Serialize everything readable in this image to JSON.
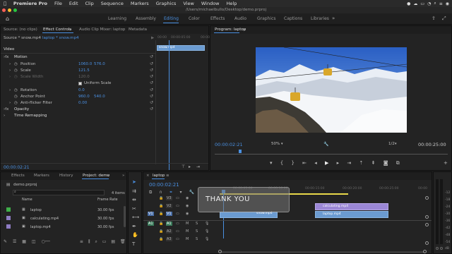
{
  "menubar": {
    "apple": "",
    "app": "Premiere Pro",
    "items": [
      "File",
      "Edit",
      "Clip",
      "Sequence",
      "Markers",
      "Graphics",
      "View",
      "Window",
      "Help"
    ]
  },
  "title": "/Users/michaelbullo/Desktop/demo.prproj",
  "workspaces": {
    "tabs": [
      "Learning",
      "Assembly",
      "Editing",
      "Color",
      "Effects",
      "Audio",
      "Graphics",
      "Captions",
      "Libraries"
    ],
    "active": "Editing"
  },
  "source_panel": {
    "tabs": [
      "Source: (no clips)",
      "Effect Controls",
      "Audio Clip Mixer: laptop",
      "Metadata"
    ],
    "active_tab": "Effect Controls",
    "source_select": "Source * snow.mp4",
    "sequence_select": "laptop * snow.mp4",
    "timecode_start": "00:00",
    "timecode_mid": "00:00:05:00",
    "timecode_end": "00:00",
    "clip_label": "snow.mp4",
    "section_video": "Video",
    "fx_motion": "Motion",
    "position_label": "Position",
    "position_x": "1060.0",
    "position_y": "576.0",
    "scale_label": "Scale",
    "scale_value": "121.5",
    "scale_width_label": "Scale Width",
    "scale_width_value": "120.0",
    "uniform_scale_label": "Uniform Scale",
    "rotation_label": "Rotation",
    "rotation_value": "0.0",
    "anchor_label": "Anchor Point",
    "anchor_x": "960.0",
    "anchor_y": "540.0",
    "antiflicker_label": "Anti-flicker Filter",
    "antiflicker_value": "0.00",
    "fx_opacity": "Opacity",
    "fx_time_remap": "Time Remapping",
    "bottom_timecode": "00:00:02:21"
  },
  "program": {
    "tab": "Program: laptop",
    "timecode": "00:00:02:21",
    "zoom": "50%",
    "resolution": "1/2",
    "duration": "00:00:25:00"
  },
  "project": {
    "tabs": [
      "Effects",
      "Markers",
      "History",
      "Project: demo"
    ],
    "active_tab": "Project: demo",
    "file": "demo.prproj",
    "items_count": "4 items",
    "col_name": "Name",
    "col_rate": "Frame Rate",
    "items": [
      {
        "name": "laptop",
        "rate": "30.00 fps",
        "color": "#3fae49"
      },
      {
        "name": "calculating.mp4",
        "rate": "30.00 fps",
        "color": "#8e7cc3"
      },
      {
        "name": "laptop.mp4",
        "rate": "30.00 fps",
        "color": "#8e7cc3"
      }
    ]
  },
  "timeline": {
    "tab": "laptop",
    "timecode": "00:00:02:21",
    "ruler": [
      "00:00:05:00",
      "00:00:10:00",
      "00:00:15:00",
      "00:00:20:00",
      "00:00:25:00",
      "00:00"
    ],
    "video_tracks": [
      "V3",
      "V2",
      "V1"
    ],
    "audio_tracks": [
      "A1",
      "A2",
      "A3"
    ],
    "clips": {
      "title": "THANK YOU",
      "v1_clip": "snow.mp4",
      "v2_clip": "calculating.mp4",
      "v1b_clip": "laptop.mp4"
    }
  },
  "meter_labels": [
    "-12",
    "-18",
    "-24",
    "-30",
    "-36",
    "-42",
    "-48",
    "-54",
    "dB"
  ],
  "colors": {
    "accent": "#4a90e2",
    "clip_purple": "#9b87d6",
    "clip_blue": "#6b9bd1",
    "yellow": "#e8d84a"
  }
}
